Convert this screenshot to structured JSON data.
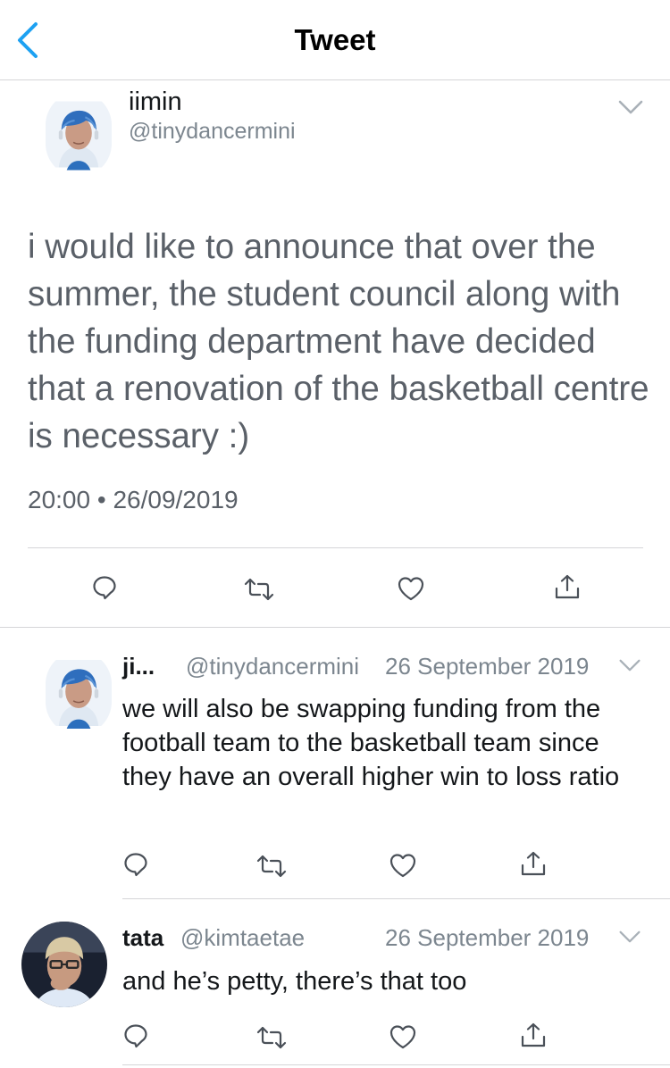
{
  "nav": {
    "title": "Tweet"
  },
  "main_tweet": {
    "name": "iimin",
    "handle": "@tinydancermini",
    "text": "i would like to announce that over the summer, the student council along with the funding department have decided that a renovation of the basketball centre is necessary :)",
    "time": "20:00",
    "separator": "•",
    "date": "26/09/2019"
  },
  "replies": [
    {
      "name": "ji...",
      "handle": "@tinydancermini",
      "date": "26 September 2019",
      "text": "we will also be swapping funding from the football team to the basketball team since they have an overall higher win to loss ratio"
    },
    {
      "name": "tata",
      "handle": "@kimtaetae",
      "date": "26 September 2019",
      "text": "and he’s petty, there’s that too"
    }
  ],
  "icons": [
    "back-chevron-icon",
    "chevron-down-icon",
    "reply-icon",
    "retweet-icon",
    "like-icon",
    "share-icon"
  ],
  "colors": {
    "accent": "#1da1f2",
    "secondary_text": "#7c868f",
    "divider": "#d5d5d8"
  }
}
